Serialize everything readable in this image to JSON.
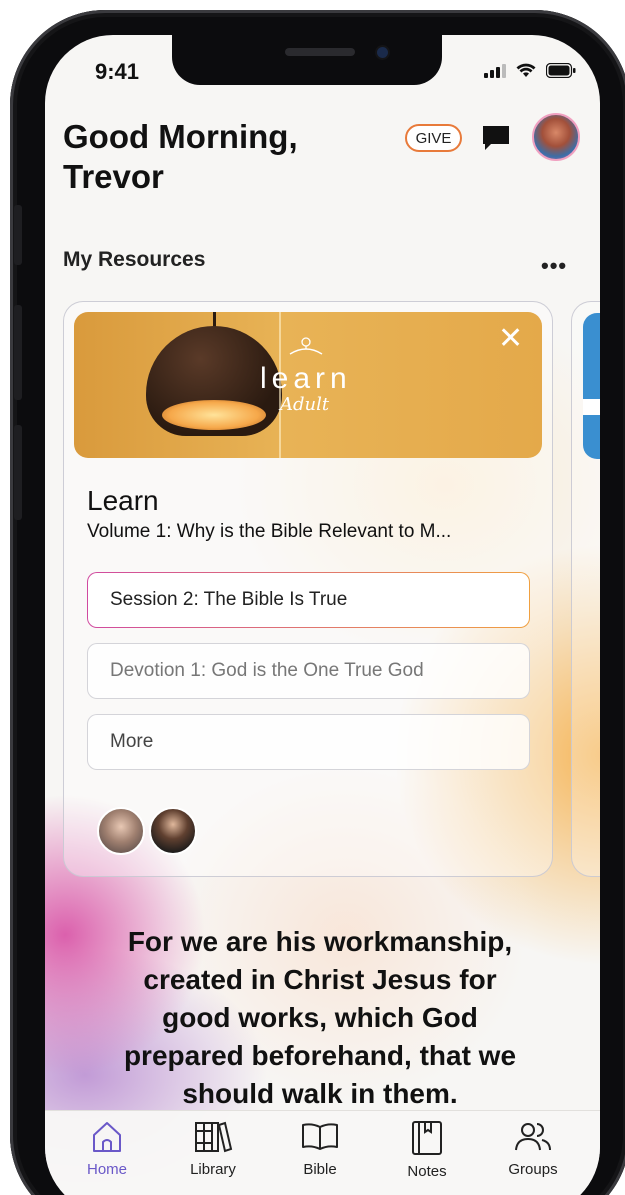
{
  "status_bar": {
    "time": "9:41"
  },
  "header": {
    "greeting": "Good Morning,",
    "name": "Trevor",
    "give_label": "GIVE"
  },
  "resources": {
    "title": "My Resources",
    "more_label": "•••",
    "card": {
      "brand_word": "learn",
      "brand_sub": "Adult",
      "close_label": "✕",
      "title": "Learn",
      "subtitle": "Volume 1: Why is the Bible Relevant to M...",
      "items": [
        {
          "label": "Session 2: The Bible Is True",
          "state": "active"
        },
        {
          "label": "Devotion 1: God is the One True God",
          "state": "muted"
        },
        {
          "label": "More",
          "state": "plain"
        }
      ]
    }
  },
  "verse": {
    "line1": "For we are his workmanship,",
    "line2": "created in Christ Jesus for",
    "line3": "good works, which God",
    "line4": "prepared beforehand, that we",
    "line5": "should walk in them."
  },
  "tabs": [
    {
      "label": "Home",
      "icon": "home-icon",
      "active": true
    },
    {
      "label": "Library",
      "icon": "library-icon",
      "active": false
    },
    {
      "label": "Bible",
      "icon": "bible-icon",
      "active": false
    },
    {
      "label": "Notes",
      "icon": "notes-icon",
      "active": false
    },
    {
      "label": "Groups",
      "icon": "groups-icon",
      "active": false
    }
  ],
  "colors": {
    "accent": "#6a58c8",
    "give_border": "#e87a3a"
  }
}
